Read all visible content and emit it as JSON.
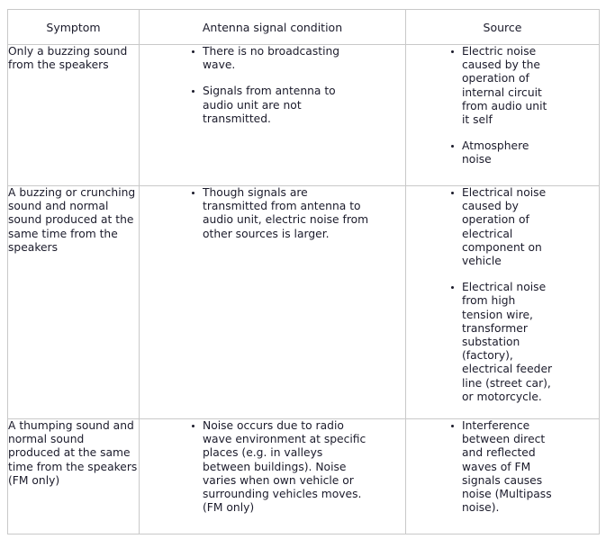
{
  "table": {
    "name": "radio-noise-troubleshooting-table",
    "headers": [
      "Symptom",
      "Antenna signal condition",
      "Source"
    ],
    "rows": [
      {
        "symptom": "Only a buzzing sound\nfrom the speakers",
        "condition_bullets": [
          "There is no broadcasting\nwave.",
          "Signals from antenna to\naudio unit are not\ntransmitted."
        ],
        "source_bullets": [
          "Electric noise\ncaused by the\noperation of\ninternal circuit\nfrom audio unit\nit self",
          "Atmosphere\nnoise"
        ]
      },
      {
        "symptom": "A buzzing or crunching\nsound and normal\nsound produced at the\nsame time from the\nspeakers",
        "condition_bullets": [
          "Though signals are\ntransmitted from antenna to\naudio unit, electric noise from\nother sources is larger."
        ],
        "source_bullets": [
          "Electrical noise\ncaused by\noperation of\nelectrical\ncomponent on\nvehicle",
          "Electrical noise\nfrom high\ntension wire,\ntransformer\nsubstation\n(factory),\nelectrical feeder\nline (street car),\nor motorcycle."
        ]
      },
      {
        "symptom": "A thumping sound and\nnormal sound\nproduced at the same\ntime from the speakers\n(FM only)",
        "condition_bullets": [
          "Noise occurs due to radio\nwave environment at specific\nplaces (e.g. in valleys\nbetween buildings). Noise\nvaries when own vehicle or\nsurrounding vehicles moves.\n(FM only)"
        ],
        "source_bullets": [
          "Interference\nbetween direct\nand reflected\nwaves of FM\nsignals causes\nnoise (Multipass\nnoise)."
        ]
      }
    ]
  },
  "colors": {
    "border": "#c9c9c9",
    "text": "#1b1b2b",
    "background": "#ffffff"
  }
}
